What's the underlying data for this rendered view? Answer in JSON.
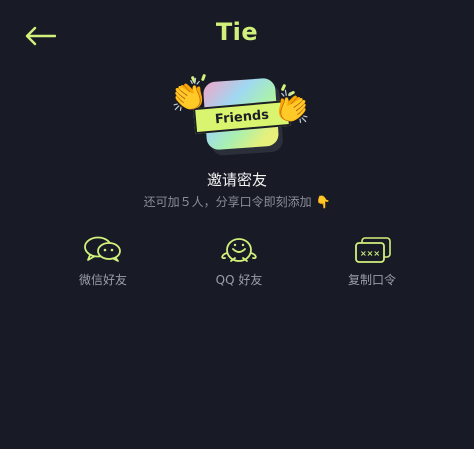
{
  "header": {
    "title": "Tie"
  },
  "hero": {
    "ribbon_text": "Friends"
  },
  "invite": {
    "title": "邀请密友",
    "subtitle": "还可加５人，分享口令即刻添加",
    "subtitle_emoji": "👇"
  },
  "share": [
    {
      "label": "微信好友",
      "icon": "wechat-icon"
    },
    {
      "label": "QQ 好友",
      "icon": "qq-icon"
    },
    {
      "label": "复制口令",
      "icon": "copy-code-icon"
    }
  ],
  "colors": {
    "background": "#181b25",
    "accent": "#d2f07c",
    "muted_text": "#8a8e98"
  }
}
